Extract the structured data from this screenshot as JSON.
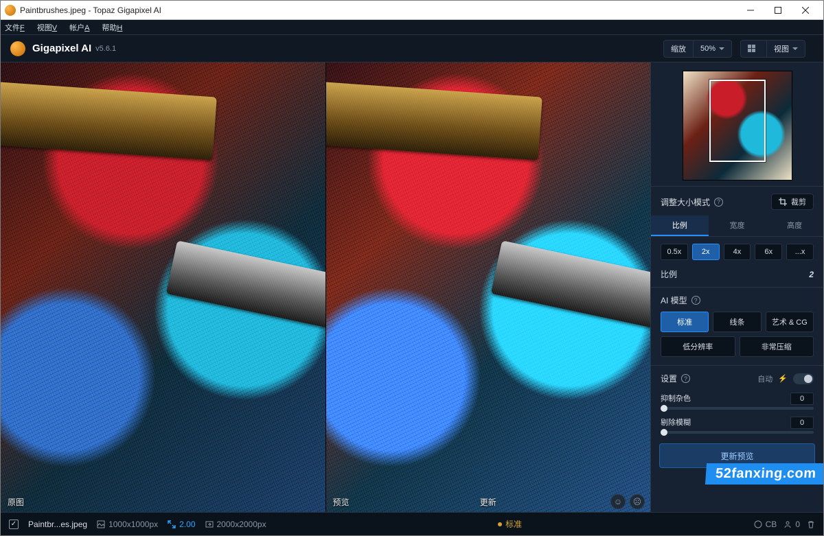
{
  "window": {
    "title": "Paintbrushes.jpeg - Topaz Gigapixel AI"
  },
  "menubar": {
    "file": "文件",
    "file_key": "F",
    "view": "视图",
    "view_key": "V",
    "account": "帐户",
    "account_key": "A",
    "help": "帮助",
    "help_key": "H"
  },
  "header": {
    "app_name": "Gigapixel AI",
    "version": "v5.6.1",
    "zoom_label": "缩放",
    "zoom_value": "50%",
    "view_label": "视图"
  },
  "viewer": {
    "left_label": "原图",
    "right_preview_label": "预览",
    "right_update_label": "更新"
  },
  "panel": {
    "resize_label": "调整大小模式",
    "crop_label": "裁剪",
    "tabs": {
      "ratio": "比例",
      "width": "宽度",
      "height": "高度"
    },
    "scale_buttons": [
      "0.5x",
      "2x",
      "4x",
      "6x",
      "...x"
    ],
    "scale_active_index": 1,
    "scale_row_label": "比例",
    "scale_value": "2",
    "ai_model_label": "AI 模型",
    "models_row1": [
      "标准",
      "线条",
      "艺术 & CG"
    ],
    "models_row1_active": 0,
    "models_row2": [
      "低分辨率",
      "非常压缩"
    ],
    "settings_label": "设置",
    "auto_label": "自动",
    "slider_noise_label": "抑制杂色",
    "slider_noise_value": "0",
    "slider_blur_label": "剔除模糊",
    "slider_blur_value": "0",
    "update_preview_label": "更新预览"
  },
  "status": {
    "filename": "Paintbr...es.jpeg",
    "input_dims": "1000x1000px",
    "scale": "2.00",
    "output_dims": "2000x2000px",
    "model_short": "标准",
    "cb_label": "CB",
    "people_count": "0"
  },
  "watermark": "52fanxing.com"
}
